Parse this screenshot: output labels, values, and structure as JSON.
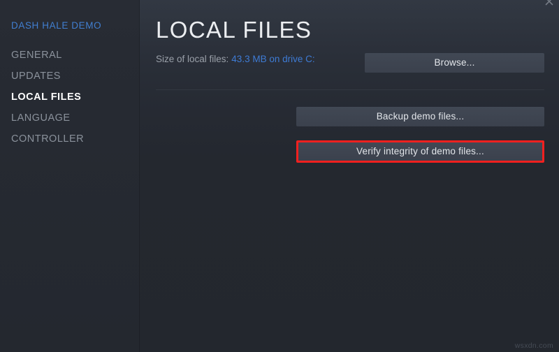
{
  "sidebar": {
    "game_title": "DASH HALE DEMO",
    "items": [
      {
        "label": "GENERAL",
        "active": false
      },
      {
        "label": "UPDATES",
        "active": false
      },
      {
        "label": "LOCAL FILES",
        "active": true
      },
      {
        "label": "LANGUAGE",
        "active": false
      },
      {
        "label": "CONTROLLER",
        "active": false
      }
    ]
  },
  "main": {
    "page_title": "LOCAL FILES",
    "size_label": "Size of local files:",
    "size_value": "43.3 MB on drive C:",
    "browse_label": "Browse...",
    "backup_label": "Backup demo files...",
    "verify_label": "Verify integrity of demo files..."
  },
  "window": {
    "close_icon": "close-icon"
  },
  "watermark": {
    "text": "wsxdn.com"
  },
  "colors": {
    "accent_blue": "#3e7bd4",
    "sidebar_title_blue": "#417fd1",
    "highlight_red": "#f3201f",
    "button_fill": "#3d4450",
    "panel_bg": "#23272e",
    "sidebar_bg": "#272b33",
    "active_item": "#ffffff",
    "muted_text": "#8b929c"
  }
}
